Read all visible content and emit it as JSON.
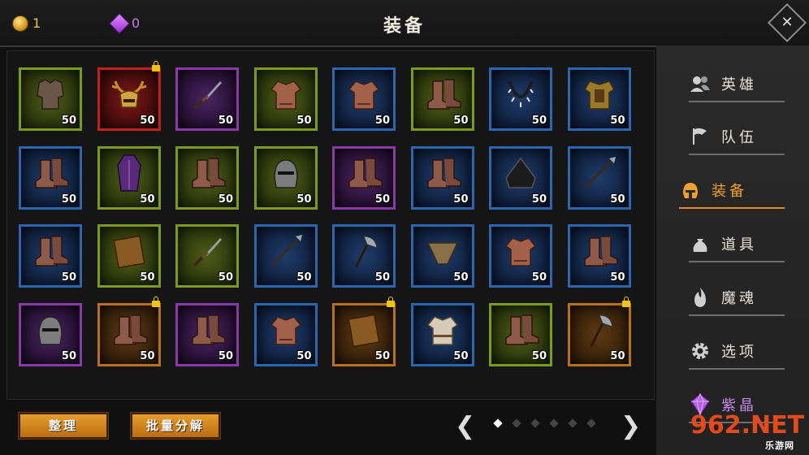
{
  "header": {
    "title": "装备",
    "coins": "1",
    "gems": "0",
    "close_icon": "close-icon"
  },
  "grid": {
    "rows": [
      [
        {
          "rarity": "green",
          "icon": "chest-armor",
          "level": "50",
          "locked": false
        },
        {
          "rarity": "red",
          "icon": "antler-helmet",
          "level": "50",
          "locked": true
        },
        {
          "rarity": "purple",
          "icon": "dagger",
          "level": "50",
          "locked": false
        },
        {
          "rarity": "green",
          "icon": "leather-armor",
          "level": "50",
          "locked": false
        },
        {
          "rarity": "blue",
          "icon": "leather-armor",
          "level": "50",
          "locked": false
        },
        {
          "rarity": "green",
          "icon": "boots",
          "level": "50",
          "locked": false
        },
        {
          "rarity": "blue",
          "icon": "necklace",
          "level": "50",
          "locked": false
        },
        {
          "rarity": "blue",
          "icon": "gold-armor",
          "level": "50",
          "locked": false
        }
      ],
      [
        {
          "rarity": "blue",
          "icon": "boots",
          "level": "50",
          "locked": false
        },
        {
          "rarity": "green",
          "icon": "robe",
          "level": "50",
          "locked": false
        },
        {
          "rarity": "green",
          "icon": "boots",
          "level": "50",
          "locked": false
        },
        {
          "rarity": "green",
          "icon": "helmet",
          "level": "50",
          "locked": false
        },
        {
          "rarity": "purple",
          "icon": "boots",
          "level": "50",
          "locked": false
        },
        {
          "rarity": "blue",
          "icon": "boots",
          "level": "50",
          "locked": false
        },
        {
          "rarity": "blue",
          "icon": "hood",
          "level": "50",
          "locked": false
        },
        {
          "rarity": "blue",
          "icon": "spear",
          "level": "50",
          "locked": false
        }
      ],
      [
        {
          "rarity": "blue",
          "icon": "boots",
          "level": "50",
          "locked": false
        },
        {
          "rarity": "green",
          "icon": "book",
          "level": "50",
          "locked": false
        },
        {
          "rarity": "green",
          "icon": "dagger",
          "level": "50",
          "locked": false
        },
        {
          "rarity": "blue",
          "icon": "spear",
          "level": "50",
          "locked": false
        },
        {
          "rarity": "blue",
          "icon": "axe",
          "level": "50",
          "locked": false
        },
        {
          "rarity": "blue",
          "icon": "scarf",
          "level": "50",
          "locked": false
        },
        {
          "rarity": "blue",
          "icon": "leather-armor",
          "level": "50",
          "locked": false
        },
        {
          "rarity": "blue",
          "icon": "boots",
          "level": "50",
          "locked": false
        }
      ],
      [
        {
          "rarity": "purple",
          "icon": "helmet",
          "level": "50",
          "locked": false
        },
        {
          "rarity": "orange",
          "icon": "boots",
          "level": "50",
          "locked": true
        },
        {
          "rarity": "purple",
          "icon": "boots",
          "level": "50",
          "locked": false
        },
        {
          "rarity": "blue",
          "icon": "leather-armor",
          "level": "50",
          "locked": false
        },
        {
          "rarity": "orange",
          "icon": "book",
          "level": "50",
          "locked": true
        },
        {
          "rarity": "blue",
          "icon": "shirt",
          "level": "50",
          "locked": false
        },
        {
          "rarity": "green",
          "icon": "boots",
          "level": "50",
          "locked": false
        },
        {
          "rarity": "orange",
          "icon": "axe",
          "level": "50",
          "locked": true
        }
      ]
    ]
  },
  "sidebar": {
    "items": [
      {
        "label": "英雄",
        "icon": "heroes-icon",
        "active": false
      },
      {
        "label": "队伍",
        "icon": "flag-icon",
        "active": false
      },
      {
        "label": "装备",
        "icon": "helmet-icon",
        "active": true
      },
      {
        "label": "道具",
        "icon": "bag-icon",
        "active": false
      },
      {
        "label": "魔魂",
        "icon": "flame-icon",
        "active": false
      },
      {
        "label": "选项",
        "icon": "gear-icon",
        "active": false
      },
      {
        "label": "紫晶",
        "icon": "crystal-icon",
        "active": false
      }
    ]
  },
  "footer": {
    "sort_label": "整理",
    "bulk_label": "批量分解",
    "pages_total": 6,
    "page_current": 1
  },
  "watermark": {
    "main": "962.NET",
    "sub": "乐游网"
  },
  "colors": {
    "green": "#7e9a1e",
    "blue": "#2d66b0",
    "purple": "#8a3aa8",
    "red": "#c02020",
    "orange": "#b8701c",
    "accent": "#f0a030"
  }
}
